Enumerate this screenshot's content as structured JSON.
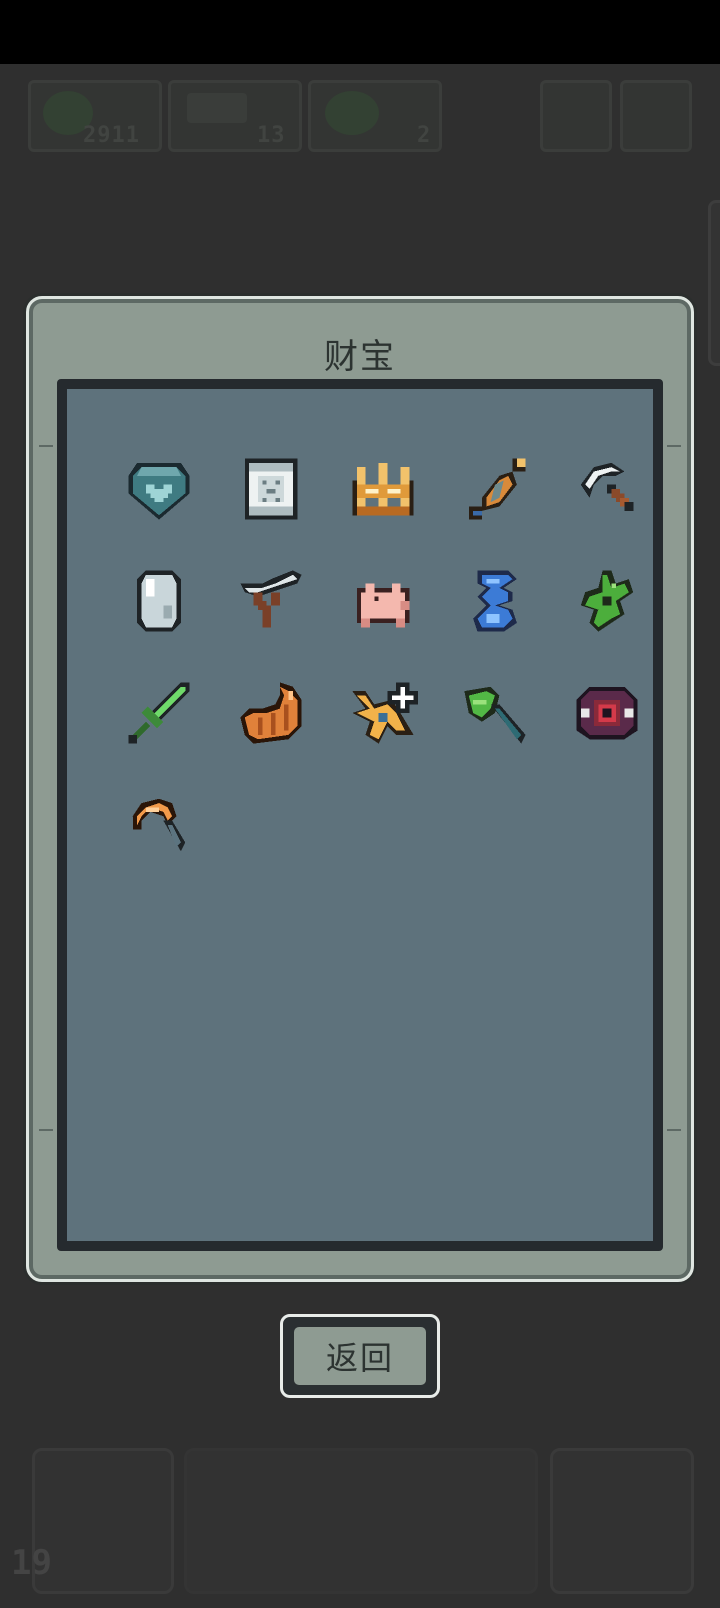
{
  "dialog": {
    "title": "财宝",
    "return_label": "返回"
  },
  "background_hud": {
    "coins": "2911",
    "materials": "13",
    "gems": "2",
    "level": "19"
  },
  "treasures": [
    {
      "name": "heart-gem-icon"
    },
    {
      "name": "scroll-icon"
    },
    {
      "name": "golden-crown-icon"
    },
    {
      "name": "seed-pod-icon"
    },
    {
      "name": "pickaxe-icon"
    },
    {
      "name": "crystal-egg-icon"
    },
    {
      "name": "slingshot-icon"
    },
    {
      "name": "piggy-bank-icon"
    },
    {
      "name": "blue-genie-bottle-icon"
    },
    {
      "name": "green-sprout-icon"
    },
    {
      "name": "green-sword-icon"
    },
    {
      "name": "croissant-icon"
    },
    {
      "name": "star-bone-plus-icon"
    },
    {
      "name": "leaf-axe-icon"
    },
    {
      "name": "red-eye-trap-icon"
    },
    {
      "name": "orange-hook-icon"
    }
  ],
  "colors": {
    "background": "#2f2f2f",
    "modal_frame": "#8e9b92",
    "inner_panel": "#5e727c",
    "title_text": "#2c3331"
  }
}
